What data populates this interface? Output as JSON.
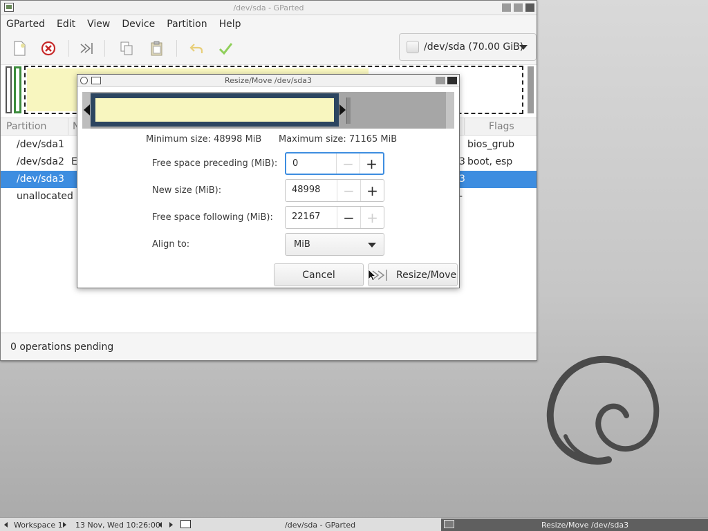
{
  "main_window": {
    "title": "/dev/sda - GParted",
    "menu": [
      "GParted",
      "Edit",
      "View",
      "Device",
      "Partition",
      "Help"
    ],
    "device_selector": "/dev/sda  (70.00 GiB)",
    "table": {
      "columns": {
        "partition": "Partition",
        "col2": "N",
        "flags": "Flags"
      },
      "rows": [
        {
          "partition": "/dev/sda1",
          "col2": "",
          "right": "",
          "flags": "bios_grub"
        },
        {
          "partition": "/dev/sda2",
          "col2": "E",
          "right": "3",
          "flags": "boot, esp"
        },
        {
          "partition": "/dev/sda3",
          "col2": "",
          "right": "3",
          "flags": ""
        },
        {
          "partition": "unallocated",
          "col2": "",
          "right": "-",
          "flags": ""
        }
      ],
      "selected_row": 2
    },
    "status": "0 operations pending"
  },
  "dialog": {
    "title": "Resize/Move /dev/sda3",
    "min_size": "Minimum size: 48998 MiB",
    "max_size": "Maximum size: 71165 MiB",
    "fields": {
      "preceding": {
        "label": "Free space preceding (MiB):",
        "value": "0"
      },
      "new_size": {
        "label": "New size (MiB):",
        "value": "48998"
      },
      "following": {
        "label": "Free space following (MiB):",
        "value": "22167"
      },
      "align": {
        "label": "Align to:",
        "value": "MiB"
      }
    },
    "buttons": {
      "cancel": "Cancel",
      "resize": "Resize/Move"
    }
  },
  "taskbar": {
    "workspace": "Workspace 1",
    "datetime": "13 Nov, Wed 10:26:00",
    "task_main": "/dev/sda - GParted",
    "task_dialog": "Resize/Move /dev/sda3"
  },
  "colors": {
    "selection": "#3d8de0",
    "partition_fill": "#f8f6bf",
    "partition_border": "#2c4560",
    "ext4_green": "#3c8c3c"
  }
}
